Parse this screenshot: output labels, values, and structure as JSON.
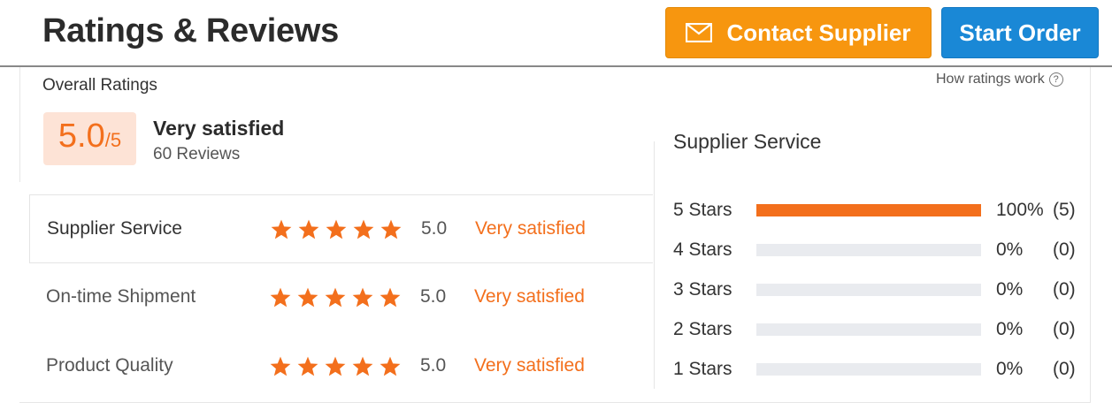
{
  "header": {
    "title": "Ratings & Reviews",
    "contact_label": "Contact Supplier",
    "order_label": "Start Order",
    "contact_color": "#f7960f",
    "order_color": "#1a88d6"
  },
  "overall": {
    "label": "Overall Ratings",
    "how_link": "How ratings work",
    "score": "5.0",
    "out_of": "/5",
    "satisfaction": "Very satisfied",
    "reviews": "60 Reviews"
  },
  "categories": [
    {
      "label": "Supplier Service",
      "stars": 5,
      "score": "5.0",
      "text": "Very satisfied"
    },
    {
      "label": "On-time Shipment",
      "stars": 5,
      "score": "5.0",
      "text": "Very satisfied"
    },
    {
      "label": "Product Quality",
      "stars": 5,
      "score": "5.0",
      "text": "Very satisfied"
    }
  ],
  "breakdown": {
    "title": "Supplier Service",
    "rows": [
      {
        "label": "5  Stars",
        "fraction": 1.0,
        "percent": "100%",
        "count": "(5)"
      },
      {
        "label": "4  Stars",
        "fraction": 0.0,
        "percent": "0%",
        "count": "(0)"
      },
      {
        "label": "3  Stars",
        "fraction": 0.0,
        "percent": "0%",
        "count": "(0)"
      },
      {
        "label": "2  Stars",
        "fraction": 0.0,
        "percent": "0%",
        "count": "(0)"
      },
      {
        "label": "1  Stars",
        "fraction": 0.0,
        "percent": "0%",
        "count": "(0)"
      }
    ]
  },
  "colors": {
    "accent": "#f36f1c",
    "track": "#e9ebef"
  },
  "icons": {
    "mail": "mail-icon",
    "help": "help-icon",
    "star": "star-icon"
  }
}
